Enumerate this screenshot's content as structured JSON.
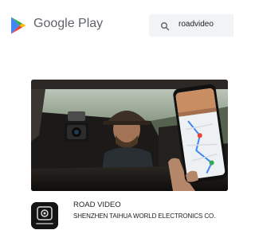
{
  "header": {
    "brand": "Google Play",
    "search": {
      "value": "roadvideo",
      "icon": "search-icon"
    }
  },
  "featured": {
    "image": "dashcam-in-car-with-phone-app-screenshot"
  },
  "app": {
    "name": "ROAD VIDEO",
    "developer": "SHENZHEN TAIHUA WORLD ELECTRONICS CO.",
    "icon_label": "ROAD VIDEO"
  },
  "colors": {
    "play_green": "#01875f",
    "play_blue": "#4285f4",
    "play_yellow": "#fbbc04",
    "play_red": "#ea4335",
    "search_bg": "#f1f3f4"
  }
}
